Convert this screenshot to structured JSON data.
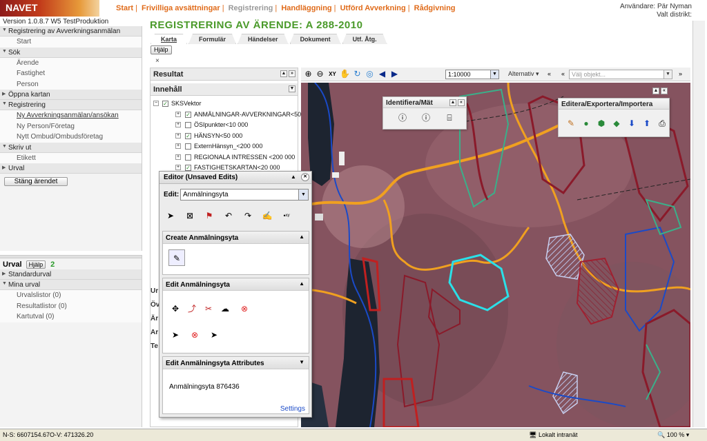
{
  "app": {
    "logo": "NAVET"
  },
  "topnav": {
    "items": [
      "Start",
      "Frivilliga avsättningar",
      "Registrering",
      "Handläggning",
      "Utförd Avverkning",
      "Rådgivning"
    ]
  },
  "user": {
    "line1": "Användare: Pär Nyman",
    "line2": "Valt distrikt:"
  },
  "version": "Version 1.0.8.7 W5 TestProduktion",
  "left": {
    "sections": [
      {
        "title": "Registrering av Avverkningsanmälan",
        "items": [
          "Start"
        ]
      },
      {
        "title": "Sök",
        "items": [
          "Ärende",
          "Fastighet",
          "Person"
        ]
      },
      {
        "title": "Öppna kartan",
        "items": []
      },
      {
        "title": "Registrering",
        "items": [
          "Ny Avverkningsanmälan/ansökan",
          "Ny Person/Företag",
          "Nytt Ombud/Ombudsföretag"
        ]
      },
      {
        "title": "Skriv ut",
        "items": [
          "Etikett"
        ]
      },
      {
        "title": "Urval",
        "items": []
      }
    ],
    "close_case_button": "Stäng ärendet"
  },
  "urval": {
    "title": "Urval",
    "help": "Hjälp",
    "refresh": "2",
    "standard": "Standardurval",
    "mina": "Mina urval",
    "items": [
      "Urvalslistor (0)",
      "Resultatlistor (0)",
      "Kartutval (0)"
    ]
  },
  "page_title": "REGISTRERING AV ÄRENDE: A 288-2010",
  "tabs": [
    "Karta",
    "Formulär",
    "Händelser",
    "Dokument",
    "Utf. Åtg."
  ],
  "help_button": "Hjälp",
  "close_x": "×",
  "tree": {
    "resultat": "Resultat",
    "innehall": "Innehåll",
    "root": "SKSVektor",
    "layers": [
      {
        "label": "ANMÄLNINGAR-AVVERKNINGAR<50 00",
        "checked": true
      },
      {
        "label": "ÖSIpunkter<10 000",
        "checked": false
      },
      {
        "label": "HÄNSYN<50 000",
        "checked": true
      },
      {
        "label": "ExternHänsyn_<200 000",
        "checked": false
      },
      {
        "label": "REGIONALA INTRESSEN <200 000",
        "checked": false
      },
      {
        "label": "FASTIGHETSKARTAN<20 000",
        "checked": true
      }
    ],
    "side_stubs": [
      "Ur",
      "Öv",
      "Är",
      "Ar",
      "Te"
    ]
  },
  "map_toolbar": {
    "scale": "1:10000",
    "alternativ": "Alternativ",
    "object_placeholder": "Välj objekt..."
  },
  "identify_panel": {
    "title": "Identifiera/Mät"
  },
  "edit_export_panel": {
    "title": "Editera/Exportera/Importera"
  },
  "editor": {
    "title": "Editor (Unsaved Edits)",
    "edit_label": "Edit:",
    "edit_value": "Anmälningsyta",
    "create_title": "Create Anmälningsyta",
    "edit_title": "Edit Anmälningsyta",
    "attr_title": "Edit Anmälningsyta Attributes",
    "attr_value": "Anmälningsyta 876436",
    "settings": "Settings"
  },
  "status": {
    "ns": "N-S: 6607154.67",
    "ov": "O-V: 471326.20",
    "zone": "Lokalt intranät",
    "zoom": "100 %"
  },
  "colors": {
    "accent_orange": "#e06b1a",
    "title_green": "#4a9a2a"
  }
}
